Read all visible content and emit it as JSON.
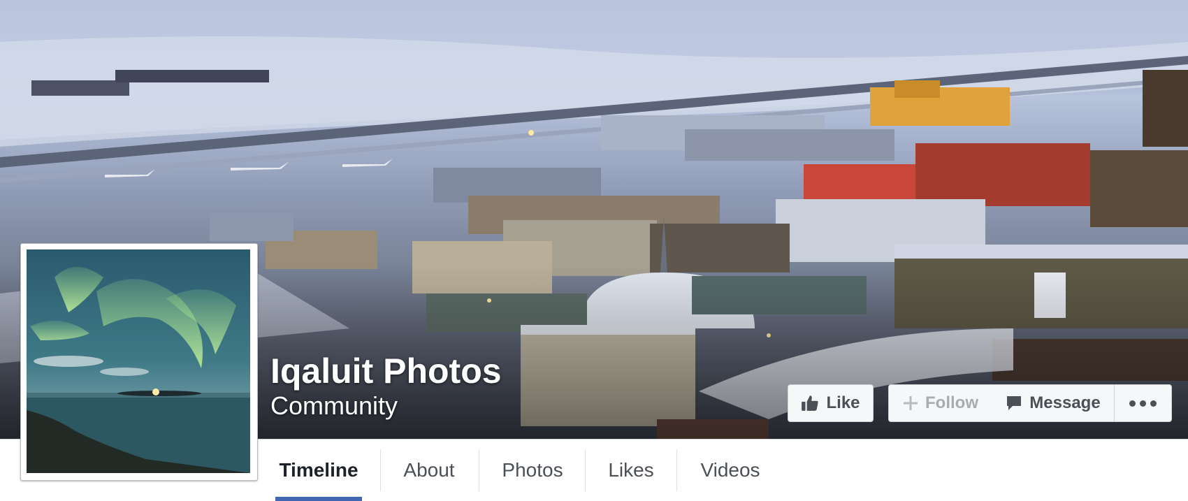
{
  "page": {
    "name": "Iqaluit Photos",
    "category": "Community"
  },
  "actions": {
    "like_label": "Like",
    "follow_label": "Follow",
    "message_label": "Message",
    "more_icon": "ellipsis-icon"
  },
  "tabs": [
    {
      "label": "Timeline",
      "active": true
    },
    {
      "label": "About",
      "active": false
    },
    {
      "label": "Photos",
      "active": false
    },
    {
      "label": "Likes",
      "active": false
    },
    {
      "label": "Videos",
      "active": false
    }
  ],
  "colors": {
    "accent": "#4267b2",
    "button_bg": "#f6f7f9",
    "button_text": "#4b4f56",
    "follow_disabled_text": "#a8abaf"
  }
}
